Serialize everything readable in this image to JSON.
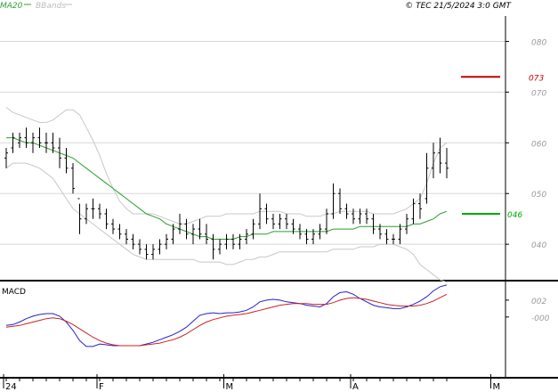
{
  "header": {
    "legend": [
      {
        "label": "MA20",
        "color": "#2e9e2e"
      },
      {
        "label": "BBands",
        "color": "#bbbbbb"
      }
    ],
    "copyright": "© TEC 21/5/2024 3:0 GMT"
  },
  "chart_data": [
    {
      "type": "ohlc",
      "ylim": [
        0.33,
        0.85
      ],
      "y_ticks": [
        {
          "value": 0.4,
          "label": "040"
        },
        {
          "value": 0.5,
          "label": "050"
        },
        {
          "value": 0.6,
          "label": "060"
        },
        {
          "value": 0.7,
          "label": "070"
        },
        {
          "value": 0.8,
          "label": "080"
        }
      ],
      "x_ticks": [
        {
          "index": 0,
          "label": "24"
        },
        {
          "index": 14,
          "label": "F"
        },
        {
          "index": 33,
          "label": "M"
        },
        {
          "index": 52,
          "label": "A"
        },
        {
          "index": 73,
          "label": "M"
        }
      ],
      "annotations": [
        {
          "label": "073",
          "value": 0.73,
          "color": "#c00000"
        },
        {
          "label": "046",
          "value": 0.46,
          "color": "#00aa00"
        }
      ],
      "price": [
        {
          "o": 0.57,
          "h": 0.59,
          "l": 0.55,
          "c": 0.58
        },
        {
          "o": 0.59,
          "h": 0.62,
          "l": 0.58,
          "c": 0.61
        },
        {
          "o": 0.6,
          "h": 0.62,
          "l": 0.59,
          "c": 0.61
        },
        {
          "o": 0.61,
          "h": 0.63,
          "l": 0.59,
          "c": 0.6
        },
        {
          "o": 0.6,
          "h": 0.62,
          "l": 0.58,
          "c": 0.61
        },
        {
          "o": 0.61,
          "h": 0.63,
          "l": 0.59,
          "c": 0.6
        },
        {
          "o": 0.6,
          "h": 0.62,
          "l": 0.58,
          "c": 0.6
        },
        {
          "o": 0.6,
          "h": 0.62,
          "l": 0.58,
          "c": 0.59
        },
        {
          "o": 0.59,
          "h": 0.61,
          "l": 0.55,
          "c": 0.57
        },
        {
          "o": 0.57,
          "h": 0.59,
          "l": 0.54,
          "c": 0.55
        },
        {
          "o": 0.55,
          "h": 0.56,
          "l": 0.5,
          "c": 0.51
        },
        {
          "o": 0.49,
          "h": 0.48,
          "l": 0.42,
          "c": 0.45
        },
        {
          "o": 0.45,
          "h": 0.48,
          "l": 0.44,
          "c": 0.47
        },
        {
          "o": 0.47,
          "h": 0.49,
          "l": 0.45,
          "c": 0.47
        },
        {
          "o": 0.47,
          "h": 0.48,
          "l": 0.45,
          "c": 0.46
        },
        {
          "o": 0.46,
          "h": 0.47,
          "l": 0.43,
          "c": 0.44
        },
        {
          "o": 0.44,
          "h": 0.45,
          "l": 0.42,
          "c": 0.43
        },
        {
          "o": 0.43,
          "h": 0.44,
          "l": 0.41,
          "c": 0.42
        },
        {
          "o": 0.42,
          "h": 0.43,
          "l": 0.4,
          "c": 0.41
        },
        {
          "o": 0.41,
          "h": 0.42,
          "l": 0.39,
          "c": 0.4
        },
        {
          "o": 0.4,
          "h": 0.41,
          "l": 0.38,
          "c": 0.39
        },
        {
          "o": 0.39,
          "h": 0.4,
          "l": 0.37,
          "c": 0.38
        },
        {
          "o": 0.38,
          "h": 0.4,
          "l": 0.37,
          "c": 0.39
        },
        {
          "o": 0.39,
          "h": 0.41,
          "l": 0.38,
          "c": 0.4
        },
        {
          "o": 0.4,
          "h": 0.42,
          "l": 0.39,
          "c": 0.41
        },
        {
          "o": 0.41,
          "h": 0.44,
          "l": 0.4,
          "c": 0.43
        },
        {
          "o": 0.43,
          "h": 0.46,
          "l": 0.42,
          "c": 0.44
        },
        {
          "o": 0.44,
          "h": 0.45,
          "l": 0.41,
          "c": 0.42
        },
        {
          "o": 0.42,
          "h": 0.44,
          "l": 0.4,
          "c": 0.43
        },
        {
          "o": 0.43,
          "h": 0.45,
          "l": 0.41,
          "c": 0.42
        },
        {
          "o": 0.42,
          "h": 0.44,
          "l": 0.4,
          "c": 0.41
        },
        {
          "o": 0.41,
          "h": 0.42,
          "l": 0.37,
          "c": 0.39
        },
        {
          "o": 0.39,
          "h": 0.41,
          "l": 0.38,
          "c": 0.4
        },
        {
          "o": 0.4,
          "h": 0.42,
          "l": 0.39,
          "c": 0.41
        },
        {
          "o": 0.41,
          "h": 0.42,
          "l": 0.39,
          "c": 0.4
        },
        {
          "o": 0.4,
          "h": 0.42,
          "l": 0.39,
          "c": 0.41
        },
        {
          "o": 0.41,
          "h": 0.43,
          "l": 0.4,
          "c": 0.42
        },
        {
          "o": 0.42,
          "h": 0.45,
          "l": 0.41,
          "c": 0.44
        },
        {
          "o": 0.44,
          "h": 0.5,
          "l": 0.43,
          "c": 0.47
        },
        {
          "o": 0.47,
          "h": 0.48,
          "l": 0.44,
          "c": 0.45
        },
        {
          "o": 0.45,
          "h": 0.46,
          "l": 0.43,
          "c": 0.44
        },
        {
          "o": 0.44,
          "h": 0.46,
          "l": 0.43,
          "c": 0.45
        },
        {
          "o": 0.45,
          "h": 0.46,
          "l": 0.43,
          "c": 0.44
        },
        {
          "o": 0.44,
          "h": 0.45,
          "l": 0.42,
          "c": 0.43
        },
        {
          "o": 0.43,
          "h": 0.44,
          "l": 0.41,
          "c": 0.42
        },
        {
          "o": 0.42,
          "h": 0.43,
          "l": 0.4,
          "c": 0.41
        },
        {
          "o": 0.41,
          "h": 0.43,
          "l": 0.4,
          "c": 0.42
        },
        {
          "o": 0.42,
          "h": 0.44,
          "l": 0.41,
          "c": 0.43
        },
        {
          "o": 0.43,
          "h": 0.47,
          "l": 0.42,
          "c": 0.46
        },
        {
          "o": 0.46,
          "h": 0.52,
          "l": 0.45,
          "c": 0.5
        },
        {
          "o": 0.5,
          "h": 0.51,
          "l": 0.46,
          "c": 0.47
        },
        {
          "o": 0.47,
          "h": 0.48,
          "l": 0.45,
          "c": 0.46
        },
        {
          "o": 0.46,
          "h": 0.47,
          "l": 0.44,
          "c": 0.45
        },
        {
          "o": 0.45,
          "h": 0.47,
          "l": 0.44,
          "c": 0.46
        },
        {
          "o": 0.46,
          "h": 0.47,
          "l": 0.44,
          "c": 0.45
        },
        {
          "o": 0.45,
          "h": 0.46,
          "l": 0.42,
          "c": 0.43
        },
        {
          "o": 0.43,
          "h": 0.44,
          "l": 0.41,
          "c": 0.42
        },
        {
          "o": 0.42,
          "h": 0.43,
          "l": 0.4,
          "c": 0.41
        },
        {
          "o": 0.41,
          "h": 0.42,
          "l": 0.4,
          "c": 0.41
        },
        {
          "o": 0.41,
          "h": 0.44,
          "l": 0.4,
          "c": 0.43
        },
        {
          "o": 0.43,
          "h": 0.46,
          "l": 0.42,
          "c": 0.45
        },
        {
          "o": 0.45,
          "h": 0.49,
          "l": 0.44,
          "c": 0.48
        },
        {
          "o": 0.48,
          "h": 0.5,
          "l": 0.45,
          "c": 0.47
        },
        {
          "o": 0.49,
          "h": 0.58,
          "l": 0.48,
          "c": 0.55
        },
        {
          "o": 0.55,
          "h": 0.6,
          "l": 0.53,
          "c": 0.58
        },
        {
          "o": 0.58,
          "h": 0.61,
          "l": 0.54,
          "c": 0.56
        },
        {
          "o": 0.56,
          "h": 0.59,
          "l": 0.53,
          "c": 0.55
        }
      ],
      "ma20": [
        0.61,
        0.61,
        0.605,
        0.6,
        0.6,
        0.595,
        0.59,
        0.585,
        0.58,
        0.575,
        0.57,
        0.56,
        0.55,
        0.54,
        0.53,
        0.52,
        0.51,
        0.5,
        0.49,
        0.48,
        0.47,
        0.46,
        0.455,
        0.45,
        0.44,
        0.435,
        0.43,
        0.425,
        0.42,
        0.415,
        0.415,
        0.41,
        0.41,
        0.41,
        0.41,
        0.415,
        0.415,
        0.42,
        0.42,
        0.42,
        0.425,
        0.425,
        0.425,
        0.425,
        0.425,
        0.425,
        0.425,
        0.425,
        0.425,
        0.43,
        0.43,
        0.43,
        0.43,
        0.435,
        0.435,
        0.435,
        0.435,
        0.435,
        0.435,
        0.435,
        0.435,
        0.44,
        0.44,
        0.445,
        0.45,
        0.46,
        0.465
      ],
      "bb_upper": [
        0.67,
        0.66,
        0.655,
        0.65,
        0.645,
        0.64,
        0.64,
        0.645,
        0.655,
        0.665,
        0.665,
        0.655,
        0.63,
        0.605,
        0.575,
        0.54,
        0.51,
        0.485,
        0.47,
        0.46,
        0.46,
        0.46,
        0.46,
        0.455,
        0.45,
        0.445,
        0.44,
        0.44,
        0.445,
        0.45,
        0.455,
        0.455,
        0.455,
        0.46,
        0.46,
        0.46,
        0.46,
        0.46,
        0.465,
        0.465,
        0.465,
        0.465,
        0.46,
        0.46,
        0.46,
        0.455,
        0.455,
        0.455,
        0.46,
        0.46,
        0.465,
        0.465,
        0.465,
        0.465,
        0.465,
        0.46,
        0.46,
        0.46,
        0.46,
        0.465,
        0.47,
        0.48,
        0.49,
        0.52,
        0.56,
        0.59,
        0.6
      ],
      "bb_lower": [
        0.55,
        0.56,
        0.56,
        0.56,
        0.555,
        0.55,
        0.54,
        0.53,
        0.51,
        0.49,
        0.47,
        0.46,
        0.45,
        0.44,
        0.43,
        0.42,
        0.41,
        0.4,
        0.39,
        0.38,
        0.375,
        0.37,
        0.37,
        0.37,
        0.37,
        0.37,
        0.37,
        0.37,
        0.37,
        0.365,
        0.365,
        0.365,
        0.365,
        0.36,
        0.36,
        0.365,
        0.37,
        0.37,
        0.375,
        0.375,
        0.38,
        0.385,
        0.385,
        0.385,
        0.385,
        0.385,
        0.385,
        0.385,
        0.385,
        0.39,
        0.39,
        0.39,
        0.39,
        0.395,
        0.395,
        0.395,
        0.4,
        0.4,
        0.4,
        0.395,
        0.39,
        0.38,
        0.36,
        0.35,
        0.34,
        0.33,
        0.325
      ]
    },
    {
      "type": "line",
      "title": "MACD",
      "ylim": [
        -0.07,
        0.04
      ],
      "y_ticks": [
        {
          "value": 0.02,
          "label": "002"
        },
        {
          "value": 0.0,
          "label": "-000"
        }
      ],
      "series": [
        {
          "color": "#2222cc",
          "values": [
            -0.01,
            -0.009,
            -0.006,
            -0.002,
            0.001,
            0.003,
            0.004,
            0.004,
            0.001,
            -0.006,
            -0.016,
            -0.028,
            -0.035,
            -0.035,
            -0.032,
            -0.033,
            -0.034,
            -0.034,
            -0.034,
            -0.034,
            -0.034,
            -0.032,
            -0.03,
            -0.027,
            -0.024,
            -0.021,
            -0.017,
            -0.012,
            -0.005,
            0.002,
            0.004,
            0.005,
            0.004,
            0.005,
            0.005,
            0.006,
            0.008,
            0.012,
            0.018,
            0.02,
            0.021,
            0.02,
            0.018,
            0.017,
            0.016,
            0.014,
            0.013,
            0.012,
            0.016,
            0.024,
            0.029,
            0.03,
            0.027,
            0.022,
            0.018,
            0.014,
            0.012,
            0.011,
            0.01,
            0.01,
            0.012,
            0.015,
            0.019,
            0.024,
            0.031,
            0.036,
            0.038
          ]
        },
        {
          "color": "#cc2222",
          "values": [
            -0.012,
            -0.011,
            -0.01,
            -0.008,
            -0.006,
            -0.004,
            -0.002,
            -0.001,
            -0.002,
            -0.005,
            -0.009,
            -0.014,
            -0.019,
            -0.024,
            -0.028,
            -0.031,
            -0.033,
            -0.034,
            -0.034,
            -0.034,
            -0.034,
            -0.033,
            -0.032,
            -0.031,
            -0.029,
            -0.027,
            -0.024,
            -0.02,
            -0.015,
            -0.01,
            -0.006,
            -0.003,
            -0.001,
            0.001,
            0.002,
            0.003,
            0.004,
            0.006,
            0.008,
            0.01,
            0.012,
            0.014,
            0.015,
            0.016,
            0.016,
            0.016,
            0.015,
            0.015,
            0.015,
            0.017,
            0.02,
            0.022,
            0.023,
            0.022,
            0.021,
            0.019,
            0.017,
            0.015,
            0.014,
            0.013,
            0.013,
            0.013,
            0.014,
            0.016,
            0.019,
            0.023,
            0.027
          ]
        }
      ]
    }
  ]
}
